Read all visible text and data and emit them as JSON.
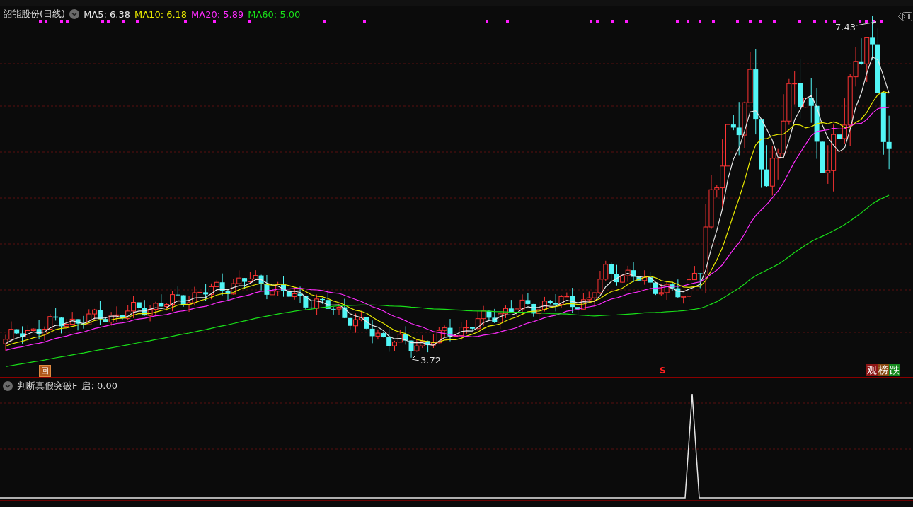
{
  "chart_title": "韶能股份(日线)",
  "ma_legend": [
    {
      "label": "MA5: 6.38",
      "color": "#e6e6e6"
    },
    {
      "label": "MA10: 6.18",
      "color": "#e8e800"
    },
    {
      "label": "MA20: 5.89",
      "color": "#ff2cff"
    },
    {
      "label": "MA60: 5.00",
      "color": "#19e019"
    }
  ],
  "high_marker": "7.43",
  "low_marker": "3.72",
  "buy_badge": "回",
  "sell_marker": "S",
  "tags": [
    {
      "text": "观",
      "color": "#8e1616"
    },
    {
      "text": "榜",
      "color": "#8a4a12"
    },
    {
      "text": "跌",
      "color": "#168a1e"
    }
  ],
  "indicator": {
    "name": "判断真假突破F",
    "reading": "启: 0.00"
  }
}
